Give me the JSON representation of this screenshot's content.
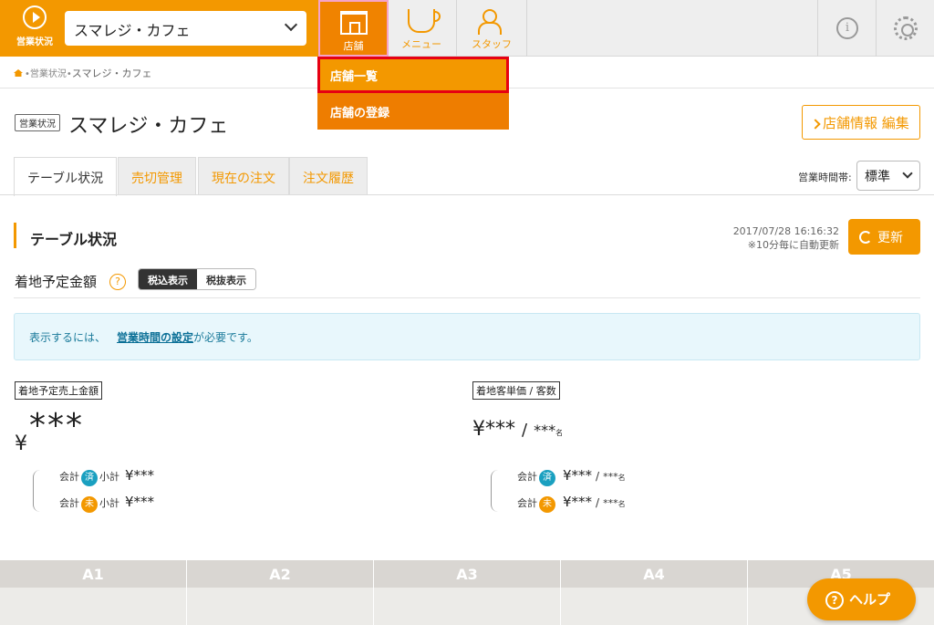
{
  "header": {
    "home_label": "営業状況",
    "store_select": "スマレジ・カフェ",
    "nav": [
      {
        "label": "店舗",
        "icon": "store-icon"
      },
      {
        "label": "メニュー",
        "icon": "cup-icon"
      },
      {
        "label": "スタッフ",
        "icon": "staff-icon"
      }
    ],
    "info_icon": "info-icon",
    "settings_icon": "gear-icon",
    "brand_color": "#f39800"
  },
  "dropdown": {
    "items": [
      "店舗一覧",
      "店舗の登録"
    ]
  },
  "breadcrumb": {
    "parent": "•営業状況•",
    "current": "スマレジ・カフェ"
  },
  "page": {
    "badge": "営業状況",
    "title": "スマレジ・カフェ",
    "edit_label": "店舗情報 編集"
  },
  "tabs": [
    "テーブル状況",
    "売切管理",
    "現在の注文",
    "注文履歴"
  ],
  "hours": {
    "label": "営業時間帯:",
    "value": "標準"
  },
  "section": {
    "title": "テーブル状況",
    "timestamp": "2017/07/28 16:16:32",
    "auto_note": "※10分毎に自動更新",
    "refresh_label": "更新"
  },
  "tax": {
    "label": "着地予定金額",
    "help": "?",
    "on": "税込表示",
    "off": "税抜表示"
  },
  "notice": {
    "prefix": "表示するには、",
    "link": "営業時間の設定",
    "suffix": "が必要です。"
  },
  "sales": {
    "tag": "着地予定売上金額",
    "yen": "¥",
    "masked": "***",
    "rows": [
      {
        "label": "会計",
        "badge": "済",
        "sub": "小計",
        "value": "¥***"
      },
      {
        "label": "会計",
        "badge": "未",
        "sub": "小計",
        "value": "¥***"
      }
    ]
  },
  "per_customer": {
    "tag": "着地客単価 / 客数",
    "yen_value": "¥***",
    "slash": "/",
    "count": "***",
    "unit": "名",
    "rows": [
      {
        "label": "会計",
        "badge": "済",
        "value": "¥***",
        "count": "***",
        "unit": "名"
      },
      {
        "label": "会計",
        "badge": "未",
        "value": "¥***",
        "count": "***",
        "unit": "名"
      }
    ]
  },
  "tables": [
    "A1",
    "A2",
    "A3",
    "A4",
    "A5"
  ],
  "help": {
    "label": "ヘルプ",
    "q": "?"
  }
}
